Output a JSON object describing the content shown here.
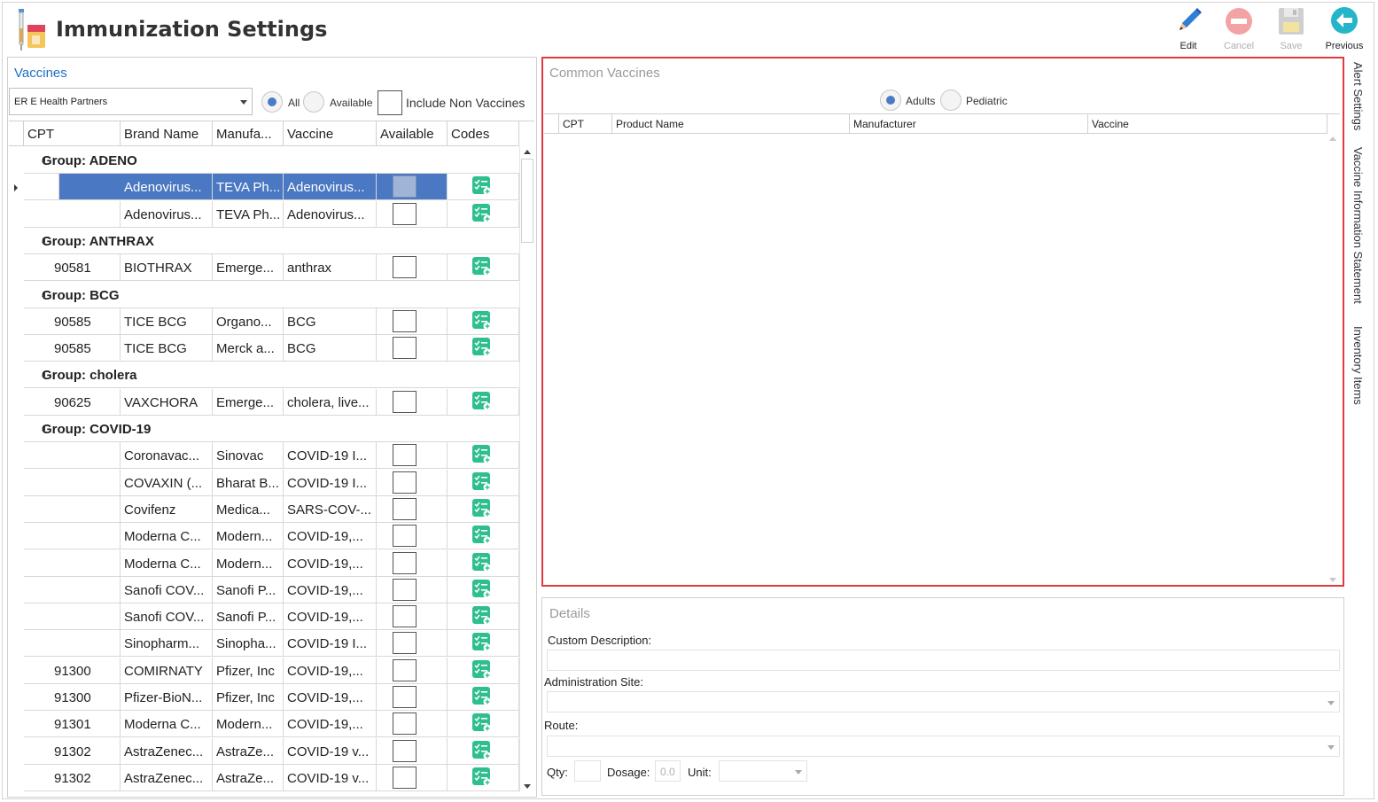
{
  "app": {
    "title": "Immunization Settings"
  },
  "toolbar": {
    "edit_label": "Edit",
    "cancel_label": "Cancel",
    "save_label": "Save",
    "previous_label": "Previous"
  },
  "vaccines": {
    "title": "Vaccines",
    "facility": "ER E Health Partners",
    "filter_all": "All",
    "filter_available": "Available",
    "include_non_vaccines": "Include Non Vaccines",
    "columns": [
      "CPT",
      "Brand Name",
      "Manufa...",
      "Vaccine",
      "Available",
      "Codes"
    ]
  },
  "groups": [
    {
      "label": "Group: ADENO",
      "rows": [
        {
          "cpt": "",
          "brand": "Adenovirus...",
          "manufacturer": "TEVA Ph...",
          "vaccine": "Adenovirus...",
          "selected": true
        },
        {
          "cpt": "",
          "brand": "Adenovirus...",
          "manufacturer": "TEVA Ph...",
          "vaccine": "Adenovirus..."
        }
      ]
    },
    {
      "label": "Group: ANTHRAX",
      "rows": [
        {
          "cpt": "90581",
          "brand": "BIOTHRAX",
          "manufacturer": "Emerge...",
          "vaccine": "anthrax"
        }
      ]
    },
    {
      "label": "Group: BCG",
      "rows": [
        {
          "cpt": "90585",
          "brand": "TICE BCG",
          "manufacturer": "Organo...",
          "vaccine": "BCG"
        },
        {
          "cpt": "90585",
          "brand": "TICE BCG",
          "manufacturer": "Merck a...",
          "vaccine": "BCG"
        }
      ]
    },
    {
      "label": "Group: cholera",
      "rows": [
        {
          "cpt": "90625",
          "brand": "VAXCHORA",
          "manufacturer": "Emerge...",
          "vaccine": "cholera, live..."
        }
      ]
    },
    {
      "label": "Group: COVID-19",
      "rows": [
        {
          "cpt": "",
          "brand": "Coronavac...",
          "manufacturer": "Sinovac",
          "vaccine": "COVID-19 I..."
        },
        {
          "cpt": "",
          "brand": "COVAXIN (...",
          "manufacturer": "Bharat B...",
          "vaccine": "COVID-19 I..."
        },
        {
          "cpt": "",
          "brand": "Covifenz",
          "manufacturer": "Medica...",
          "vaccine": "SARS-COV-..."
        },
        {
          "cpt": "",
          "brand": "Moderna C...",
          "manufacturer": "Modern...",
          "vaccine": "COVID-19,..."
        },
        {
          "cpt": "",
          "brand": "Moderna C...",
          "manufacturer": "Modern...",
          "vaccine": "COVID-19,..."
        },
        {
          "cpt": "",
          "brand": "Sanofi COV...",
          "manufacturer": "Sanofi P...",
          "vaccine": "COVID-19,..."
        },
        {
          "cpt": "",
          "brand": "Sanofi COV...",
          "manufacturer": "Sanofi P...",
          "vaccine": "COVID-19,..."
        },
        {
          "cpt": "",
          "brand": "Sinopharm...",
          "manufacturer": "Sinopha...",
          "vaccine": "COVID-19 I..."
        },
        {
          "cpt": "91300",
          "brand": "COMIRNATY",
          "manufacturer": "Pfizer, Inc",
          "vaccine": "COVID-19,..."
        },
        {
          "cpt": "91300",
          "brand": "Pfizer-BioN...",
          "manufacturer": "Pfizer, Inc",
          "vaccine": "COVID-19,..."
        },
        {
          "cpt": "91301",
          "brand": "Moderna C...",
          "manufacturer": "Modern...",
          "vaccine": "COVID-19,..."
        },
        {
          "cpt": "91302",
          "brand": "AstraZenec...",
          "manufacturer": "AstraZe...",
          "vaccine": "COVID-19 v..."
        },
        {
          "cpt": "91302",
          "brand": "AstraZenec...",
          "manufacturer": "AstraZe...",
          "vaccine": "COVID-19 v..."
        }
      ]
    }
  ],
  "common_vaccines": {
    "title": "Common Vaccines",
    "adults_label": "Adults",
    "pediatric_label": "Pediatric",
    "columns": [
      "CPT",
      "Product Name",
      "Manufacturer",
      "Vaccine"
    ]
  },
  "details": {
    "title": "Details",
    "custom_description_label": "Custom Description:",
    "administration_site_label": "Administration Site:",
    "route_label": "Route:",
    "qty_label": "Qty:",
    "dosage_label": "Dosage:",
    "dosage_placeholder": "0.0",
    "unit_label": "Unit:"
  },
  "side_tabs": [
    "Alert Settings",
    "Vaccine Information Statement",
    "Inventory Items"
  ],
  "colors": {
    "accent": "#1f6fbf",
    "selected_row": "#4a78c2",
    "highlight_border": "#e0393e",
    "codes_icon": "#2fbf8f"
  }
}
